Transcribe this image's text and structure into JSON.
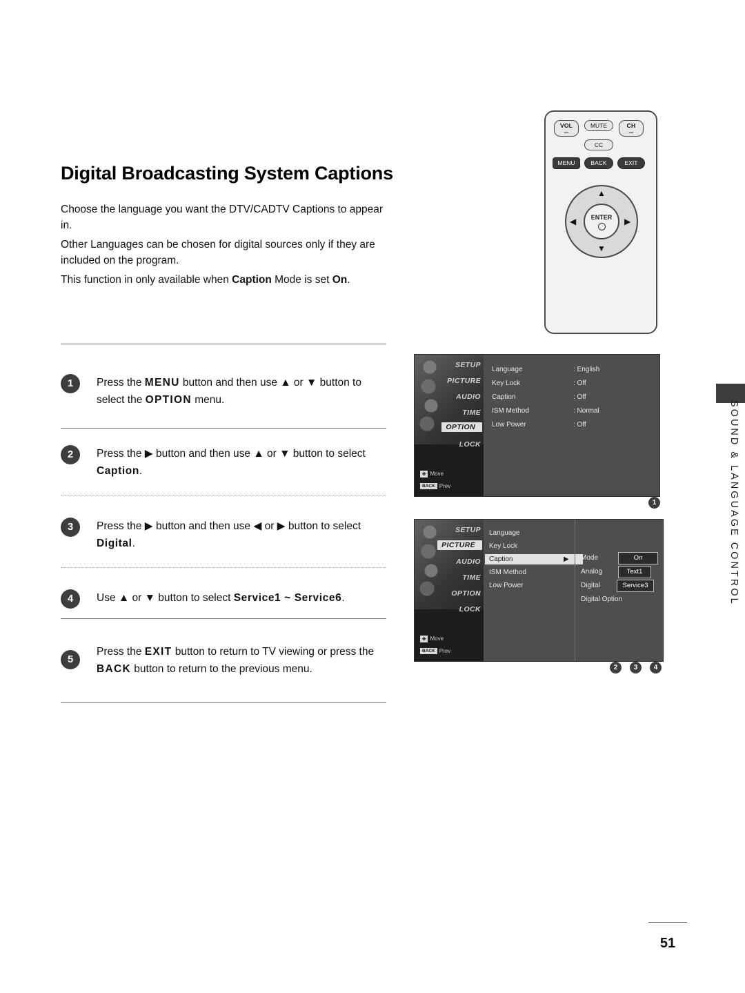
{
  "title": "Digital Broadcasting System Captions",
  "intro": {
    "p1": "Choose the language you want the DTV/CADTV Captions to appear in.",
    "p2": "Other Languages can be chosen for digital sources only if they are included on the program.",
    "p3_a": "This function in only available when ",
    "p3_b": "Caption",
    "p3_c": " Mode is set ",
    "p3_d": "On",
    "p3_e": "."
  },
  "steps": [
    {
      "num": "1",
      "a": "Press the ",
      "b1": "MENU",
      "c": " button and then use ▲ or ▼ button to select the ",
      "b2": "OPTION",
      "d": " menu."
    },
    {
      "num": "2",
      "a": "Press the ▶ button and then use ▲ or ▼ button to select ",
      "b1": "Caption",
      "c": "."
    },
    {
      "num": "3",
      "a": "Press the ▶ button and then use ◀ or ▶ button to select ",
      "b1": "Digital",
      "c": "."
    },
    {
      "num": "4",
      "a": "Use ▲ or ▼ button to select ",
      "b1": "Service1 ~ Service6",
      "c": "."
    },
    {
      "num": "5",
      "a": "Press the ",
      "b1": "EXIT",
      "c": " button to return to TV viewing or press the ",
      "b2": "BACK",
      "d": " button to return to the previous menu."
    }
  ],
  "remote": {
    "vol_label": "VOL",
    "vol_minus": "–",
    "mute": "MUTE",
    "cc": "CC",
    "ch_label": "CH",
    "ch_minus": "–",
    "menu": "MENU",
    "back": "BACK",
    "exit": "EXIT",
    "enter": "ENTER",
    "arrow_up": "▲",
    "arrow_down": "▼",
    "arrow_left": "◀",
    "arrow_right": "▶"
  },
  "osd1": {
    "menu": [
      "SETUP",
      "PICTURE",
      "AUDIO",
      "TIME",
      "OPTION",
      "LOCK"
    ],
    "selected_menu": "OPTION",
    "hint_move": "Move",
    "hint_prev": "Prev",
    "hint_prev_chip": "BACK",
    "rows": [
      {
        "label": "Language",
        "value": ": English"
      },
      {
        "label": "Key Lock",
        "value": ": Off"
      },
      {
        "label": "Caption",
        "value": ": Off"
      },
      {
        "label": "ISM Method",
        "value": ": Normal"
      },
      {
        "label": "Low Power",
        "value": ": Off"
      }
    ],
    "callout": "1"
  },
  "osd2": {
    "menu": [
      "SETUP",
      "PICTURE",
      "AUDIO",
      "TIME",
      "OPTION",
      "LOCK"
    ],
    "selected_menu": "PICTURE",
    "hint_move": "Move",
    "hint_prev": "Prev",
    "hint_prev_chip": "BACK",
    "rows": [
      {
        "label": "Language",
        "selected": false
      },
      {
        "label": "Key Lock",
        "selected": false
      },
      {
        "label": "Caption",
        "selected": true,
        "arrow": "▶"
      },
      {
        "label": "ISM Method",
        "selected": false
      },
      {
        "label": "Low Power",
        "selected": false
      }
    ],
    "sub": [
      {
        "label": "Mode",
        "value": "On"
      },
      {
        "label": "Analog",
        "value": "Text1"
      },
      {
        "label": "Digital",
        "value": "Service3"
      },
      {
        "label": "Digital Option",
        "value": ""
      }
    ],
    "callouts": [
      "2",
      "3",
      "4"
    ]
  },
  "side_label": "SOUND & LANGUAGE CONTROL",
  "page_number": "51"
}
